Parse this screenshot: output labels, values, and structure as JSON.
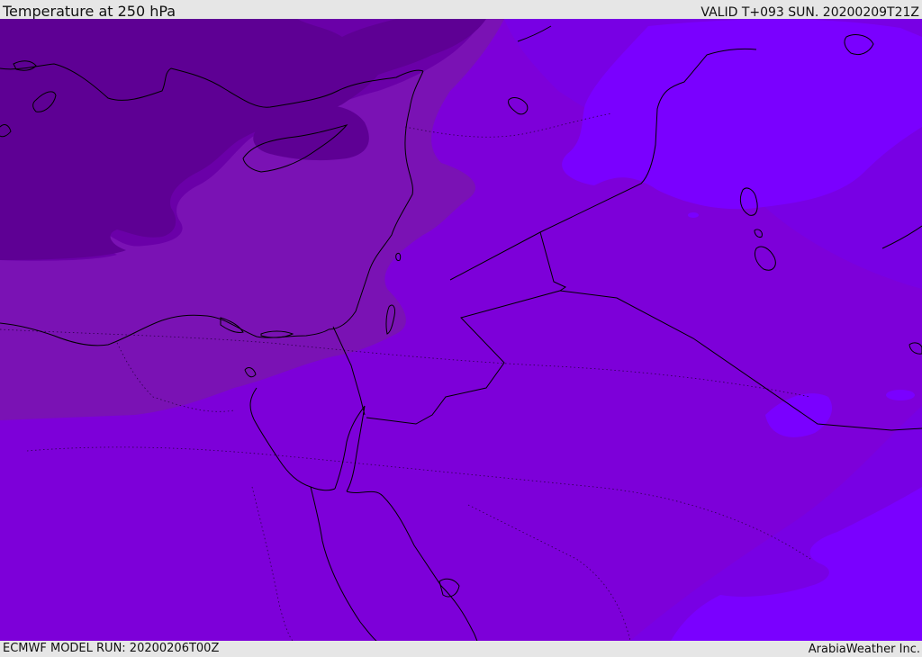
{
  "header": {
    "title": "Temperature at 250 hPa",
    "valid_label": "VALID T+093 SUN. 20200209T21Z"
  },
  "footer": {
    "model_run": "ECMWF MODEL RUN: 20200206T00Z",
    "credit": "ArabiaWeather Inc."
  },
  "map": {
    "colors": {
      "darkest_band": "#5e0094",
      "dark_band": "#6a00a8",
      "mid_band": "#7a12b4",
      "base_band": "#7d00d9",
      "east_band": "#7800e4",
      "light_band": "#7a00ff",
      "coast_line": "#000000"
    },
    "icons": {
      "coastline": "coastline-lines",
      "border": "border-lines"
    }
  }
}
